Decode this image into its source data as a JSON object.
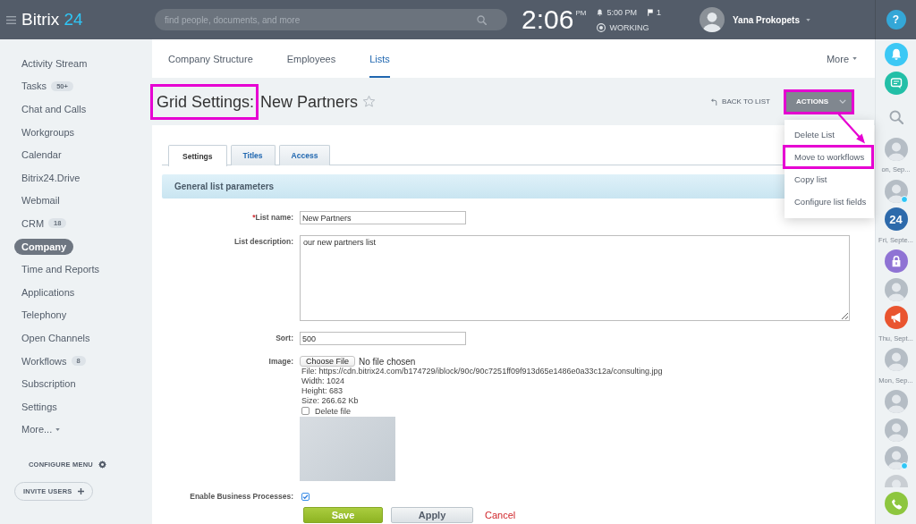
{
  "header": {
    "logo": {
      "text": "Bitrix",
      "accent": "24"
    },
    "search": {
      "placeholder": "find people, documents, and more"
    },
    "clock": {
      "time": "2:06",
      "period": "PM"
    },
    "alarm": "5:00 PM",
    "flags": "1",
    "status": "WORKING",
    "user": {
      "name": "Yana Prokopets"
    },
    "help": "?"
  },
  "sidebar": {
    "items": [
      {
        "kind": "link",
        "label": "Activity Stream",
        "selected": false
      },
      {
        "kind": "link",
        "label": "Tasks",
        "counter": "50+",
        "selected": false
      },
      {
        "kind": "link",
        "label": "Chat and Calls",
        "selected": false
      },
      {
        "kind": "link",
        "label": "Workgroups",
        "selected": false
      },
      {
        "kind": "link",
        "label": "Calendar",
        "selected": false
      },
      {
        "kind": "link",
        "label": "Bitrix24.Drive",
        "selected": false
      },
      {
        "kind": "link",
        "label": "Webmail",
        "selected": false
      },
      {
        "kind": "link",
        "label": "CRM",
        "counter": "18",
        "selected": false
      },
      {
        "kind": "link",
        "label": "Company",
        "selected": true
      },
      {
        "kind": "link",
        "label": "Time and Reports",
        "selected": false
      },
      {
        "kind": "link",
        "label": "Applications",
        "selected": false
      },
      {
        "kind": "link",
        "label": "Telephony",
        "selected": false
      },
      {
        "kind": "link",
        "label": "Open Channels",
        "selected": false
      },
      {
        "kind": "link",
        "label": "Workflows",
        "counter": "8",
        "selected": false
      },
      {
        "kind": "link",
        "label": "Subscription",
        "selected": false
      },
      {
        "kind": "link",
        "label": "Settings",
        "selected": false
      },
      {
        "kind": "more",
        "label": "More...",
        "selected": false
      }
    ],
    "configure": "CONFIGURE MENU",
    "invite": "INVITE USERS"
  },
  "top_nav": {
    "tabs": [
      {
        "label": "Company Structure",
        "selected": false
      },
      {
        "label": "Employees",
        "selected": false
      },
      {
        "label": "Lists",
        "selected": true
      }
    ],
    "more": "More"
  },
  "page": {
    "title": [
      {
        "text": "Grid Settings:",
        "highlighted": true
      },
      {
        "text": "New Partners",
        "highlighted": false
      }
    ],
    "starred": false,
    "back": "BACK TO LIST",
    "actions": {
      "label": "ACTIONS",
      "highlighted": true
    },
    "menu": [
      {
        "label": "Delete List",
        "highlighted": false
      },
      {
        "label": "Move to workflows",
        "highlighted": true
      },
      {
        "label": "Copy list",
        "highlighted": false
      },
      {
        "label": "Configure list fields",
        "highlighted": false
      }
    ],
    "callout_arrow": true
  },
  "form": {
    "tabs": [
      {
        "label": "Settings",
        "selected": true
      },
      {
        "label": "Titles",
        "selected": false
      },
      {
        "label": "Access",
        "selected": false
      }
    ],
    "section": "General list parameters",
    "fields": [
      {
        "kind": "text",
        "required_mark": "*",
        "label": "List name:",
        "value": "New Partners"
      },
      {
        "kind": "textarea",
        "label": "List description:",
        "value": "our new partners list"
      },
      {
        "kind": "text",
        "label": "Sort:",
        "value": "500"
      },
      {
        "kind": "image",
        "label": "Image:",
        "button": "Choose File",
        "status": "No file chosen",
        "details": [
          "File: https://cdn.bitrix24.com/b174729/iblock/90c/90c7251ff09f913d65e1486e0a33c12a/consulting.jpg",
          "Width: 1024",
          "Height: 683",
          "Size: 266.62 Kb"
        ],
        "delete": {
          "label": "Delete file",
          "checked": false
        }
      },
      {
        "kind": "checkbox",
        "label": "Enable Business Processes:",
        "checked": true
      }
    ],
    "buttons": [
      {
        "kind": "save",
        "label": "Save"
      },
      {
        "kind": "apply",
        "label": "Apply"
      },
      {
        "kind": "cancel",
        "label": "Cancel"
      }
    ]
  },
  "right_panel": {
    "items": [
      {
        "kind": "bell"
      },
      {
        "kind": "chat"
      },
      {
        "kind": "search"
      },
      {
        "kind": "avatar",
        "badge": false,
        "caption": "on, Sep..."
      },
      {
        "kind": "avatar",
        "badge": true
      },
      {
        "kind": "group",
        "text": "24",
        "caption": "Fri, Septe..."
      },
      {
        "kind": "lock"
      },
      {
        "kind": "avatar",
        "badge": false
      },
      {
        "kind": "megaphone",
        "caption": "Thu, Sept..."
      },
      {
        "kind": "avatar",
        "badge": false,
        "caption": "Mon, Sep..."
      },
      {
        "kind": "avatar",
        "badge": false
      },
      {
        "kind": "avatar",
        "badge": false
      },
      {
        "kind": "avatar",
        "badge": true
      },
      {
        "kind": "avatar_cut"
      },
      {
        "kind": "phone"
      }
    ]
  }
}
